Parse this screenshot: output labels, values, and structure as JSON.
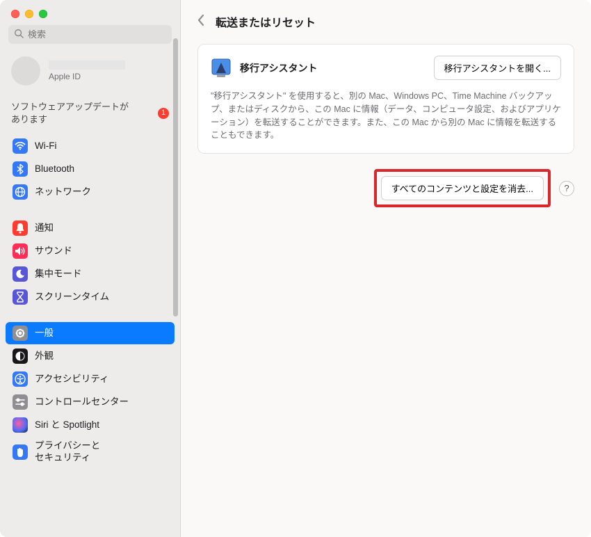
{
  "window": {
    "title": "転送またはリセット"
  },
  "search": {
    "placeholder": "検索"
  },
  "account": {
    "apple_id_label": "Apple ID"
  },
  "update": {
    "text": "ソフトウェアアップデートがあります",
    "badge": "1"
  },
  "nav": {
    "wifi": "Wi-Fi",
    "bluetooth": "Bluetooth",
    "network": "ネットワーク",
    "notifications": "通知",
    "sound": "サウンド",
    "focus": "集中モード",
    "screentime": "スクリーンタイム",
    "general": "一般",
    "appearance": "外観",
    "accessibility": "アクセシビリティ",
    "control_center": "コントロールセンター",
    "siri": "Siri と Spotlight",
    "privacy": "プライバシーと\nセキュリティ"
  },
  "main": {
    "assistant": {
      "title": "移行アシスタント",
      "open_btn": "移行アシスタントを開く...",
      "description": "\"移行アシスタント\" を使用すると、別の Mac、Windows PC、Time Machine バックアップ、またはディスクから、この Mac に情報（データ、コンピュータ設定、およびアプリケーション）を転送することができます。また、この Mac から別の Mac に情報を転送することもできます。"
    },
    "erase_btn": "すべてのコンテンツと設定を消去...",
    "help": "?"
  },
  "colors": {
    "wifi": "#3478f6",
    "bluetooth": "#3478f6",
    "network": "#3478f6",
    "notifications": "#ff3b30",
    "sound": "#ff3b55",
    "focus": "#5856d6",
    "screentime": "#5856d6",
    "general": "#8e8e93",
    "appearance": "#000",
    "accessibility": "#3478f6",
    "control_center": "#8e8e93",
    "siri": "#1d1d1f",
    "privacy": "#3478f6"
  }
}
